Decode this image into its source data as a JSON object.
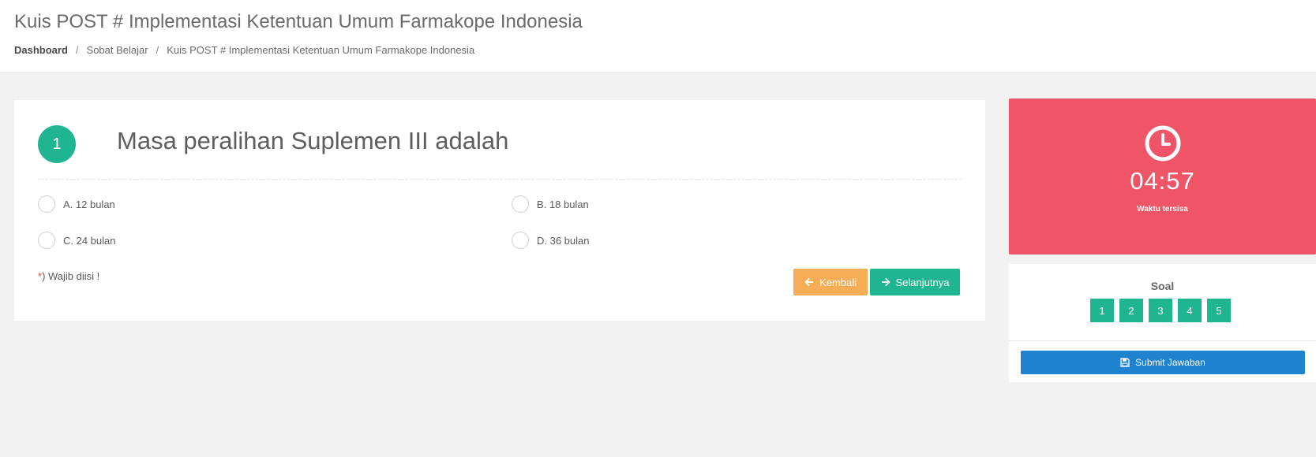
{
  "header": {
    "title": "Kuis POST # Implementasi Ketentuan Umum Farmakope Indonesia",
    "breadcrumb": [
      "Dashboard",
      "Sobat Belajar",
      "Kuis POST # Implementasi Ketentuan Umum Farmakope Indonesia"
    ],
    "breadcrumb_separator": "/"
  },
  "question": {
    "number": "1",
    "text": "Masa peralihan Suplemen III adalah",
    "options": [
      {
        "label": "A. 12 bulan"
      },
      {
        "label": "B. 18 bulan"
      },
      {
        "label": "C. 24 bulan"
      },
      {
        "label": "D. 36 bulan"
      }
    ],
    "required_star": "*",
    "required_text": ") Wajib diisi !"
  },
  "buttons": {
    "back_label": "Kembali",
    "next_label": "Selanjutnya",
    "submit_label": "Submit Jawaban"
  },
  "timer": {
    "value": "04:57",
    "label": "Waktu tersisa",
    "icon": "clock-icon"
  },
  "soal": {
    "title": "Soal",
    "items": [
      "1",
      "2",
      "3",
      "4",
      "5"
    ]
  },
  "colors": {
    "accent": "#1fb591",
    "timer_bg": "#ef5566",
    "back_button": "#f6ad55",
    "submit_button": "#1f82cf"
  }
}
